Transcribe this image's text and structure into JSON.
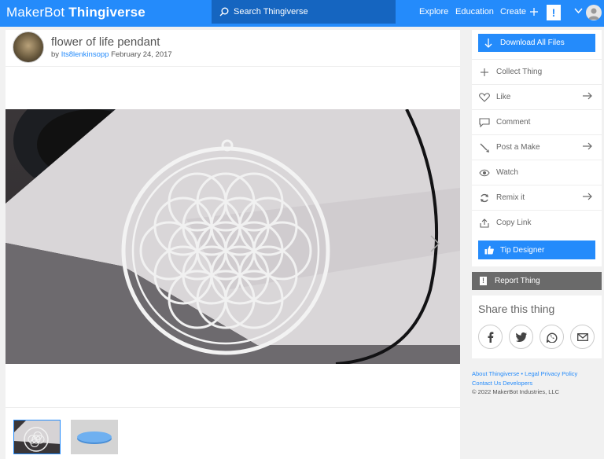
{
  "header": {
    "logo_prefix": "MakerBot",
    "logo_name": "Thingiverse",
    "search_placeholder": "Search Thingiverse",
    "nav": {
      "explore": "Explore",
      "education": "Education",
      "create": "Create"
    },
    "notification_glyph": "!"
  },
  "thing": {
    "title": "flower of life pendant",
    "by": "by",
    "author": "Its8lenkinsopp",
    "date": "February 24, 2017"
  },
  "actions": {
    "download": "Download All Files",
    "collect": "Collect Thing",
    "like": "Like",
    "comment": "Comment",
    "post_make": "Post a Make",
    "watch": "Watch",
    "remix": "Remix it",
    "copy_link": "Copy Link",
    "tip": "Tip Designer"
  },
  "report": "Report Thing",
  "share": {
    "title": "Share this thing"
  },
  "footer": {
    "about": "About Thingiverse",
    "legal": "Legal",
    "privacy": "Privacy Policy",
    "contact": "Contact Us",
    "developers": "Developers",
    "copyright": "© 2022 MakerBot Industries, LLC"
  },
  "colors": {
    "brand": "#248bfb",
    "search_bg": "#1565c0",
    "report_bg": "#6a6a6a"
  }
}
